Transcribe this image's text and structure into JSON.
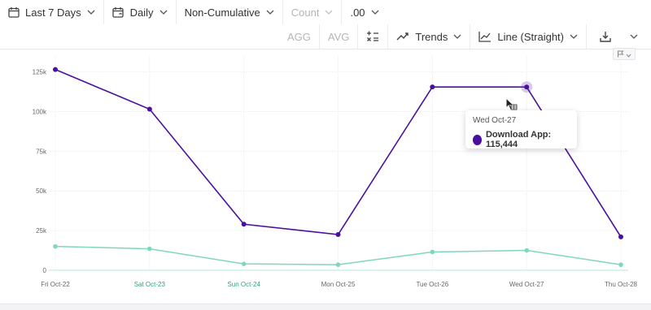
{
  "toolbar": {
    "date_range": "Last 7 Days",
    "interval": "Daily",
    "cumulative": "Non-Cumulative",
    "count": "Count",
    "decimals": ".00",
    "agg": "AGG",
    "avg": "AVG",
    "trends": "Trends",
    "line_style": "Line (Straight)"
  },
  "tooltip": {
    "date": "Wed Oct-27",
    "series": "Download App",
    "value": "115,444",
    "label": "Download App: 115,444"
  },
  "colors": {
    "primary_series": "#4b0fa0",
    "secondary_series": "#7fd8b8",
    "weekend_label": "#2fa37c"
  },
  "chart_data": {
    "type": "line",
    "categories": [
      "Fri Oct-22",
      "Sat Oct-23",
      "Sun Oct-24",
      "Mon Oct-25",
      "Tue Oct-26",
      "Wed Oct-27",
      "Thu Oct-28"
    ],
    "weekend_categories": [
      "Sat Oct-23",
      "Sun Oct-24"
    ],
    "series": [
      {
        "values": [
          126500,
          101500,
          29000,
          22500,
          115500,
          115444,
          21000
        ]
      },
      {
        "values": [
          15000,
          13500,
          4000,
          3500,
          11500,
          12500,
          3500
        ]
      }
    ],
    "yticks": [
      0,
      25000,
      50000,
      75000,
      100000,
      125000
    ],
    "ytick_labels": [
      "0",
      "25k",
      "50k",
      "75k",
      "100k",
      "125k"
    ],
    "ylim": [
      0,
      135000
    ],
    "grid": true,
    "highlight_index": 5
  }
}
